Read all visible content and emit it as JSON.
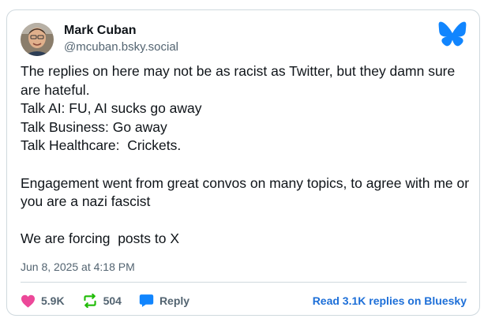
{
  "author": {
    "name": "Mark Cuban",
    "handle": "@mcuban.bsky.social"
  },
  "post": {
    "lines": [
      "The replies on here may not be as racist as Twitter, but they damn sure are hateful.",
      "Talk AI: FU, AI sucks go away",
      "Talk Business: Go away",
      "Talk Healthcare:  Crickets.",
      "",
      "Engagement went from great convos on many topics, to agree with me or you are a nazi fascist",
      "",
      "We are forcing  posts to X"
    ],
    "timestamp": "Jun 8, 2025 at 4:18 PM"
  },
  "actions": {
    "likes": "5.9K",
    "reposts": "504",
    "reply_label": "Reply",
    "read_replies": "Read 3.1K replies on Bluesky"
  },
  "icons": {
    "logo": "bluesky-butterfly-icon",
    "like": "heart-icon",
    "repost": "repost-icon",
    "reply": "speech-bubble-icon"
  },
  "colors": {
    "brand": "#1185fe",
    "like": "#ec4899",
    "repost": "#20bc07",
    "reply": "#1185fe",
    "link": "#1d6fd8"
  }
}
